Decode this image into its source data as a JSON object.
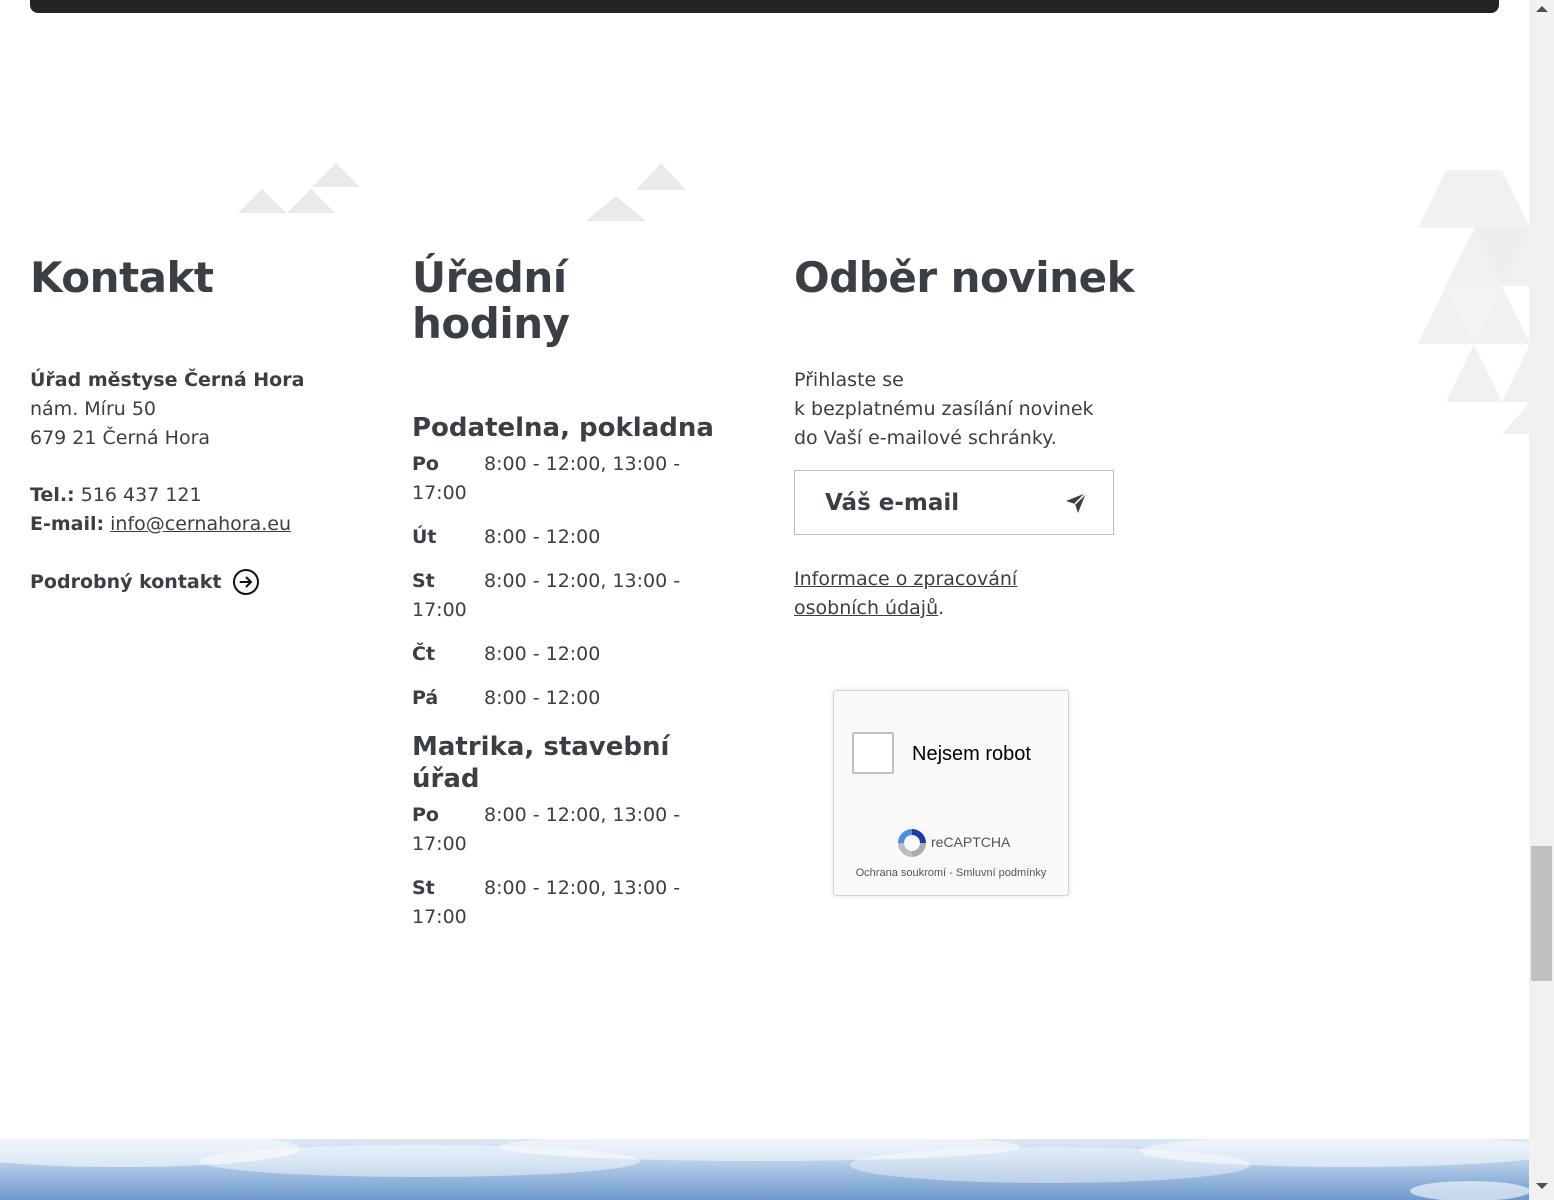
{
  "contact": {
    "heading": "Kontakt",
    "org_name": "Úřad městyse Černá Hora",
    "street": "nám. Míru 50",
    "city": "679 21 Černá Hora",
    "tel_label": "Tel.:",
    "tel_value": "516 437 121",
    "email_label": "E-mail:",
    "email_value": "info@cernahora.eu",
    "detail_link": "Podrobný kontakt"
  },
  "hours": {
    "heading": "Úřední hodiny",
    "groups": [
      {
        "title": "Podatelna, pokladna",
        "rows": [
          {
            "day": "Po",
            "time": "8:00 - 12:00, 13:00 -",
            "time_cont": "17:00"
          },
          {
            "day": "Út",
            "time": "8:00 - 12:00",
            "time_cont": ""
          },
          {
            "day": "St",
            "time": "8:00 - 12:00, 13:00 -",
            "time_cont": "17:00"
          },
          {
            "day": "Čt",
            "time": "8:00 - 12:00",
            "time_cont": ""
          },
          {
            "day": "Pá",
            "time": "8:00 - 12:00",
            "time_cont": ""
          }
        ]
      },
      {
        "title": "Matrika, stavební úřad",
        "rows": [
          {
            "day": "Po",
            "time": "8:00 - 12:00, 13:00 -",
            "time_cont": "17:00"
          },
          {
            "day": "St",
            "time": "8:00 - 12:00, 13:00 -",
            "time_cont": "17:00"
          }
        ]
      }
    ]
  },
  "newsletter": {
    "heading": "Odběr novinek",
    "intro_line1": "Přihlaste se",
    "intro_line2": "k bezplatnému zasílání novinek",
    "intro_line3": "do Vaší e-mailové schránky.",
    "email_placeholder": "Váš e-mail",
    "privacy_line1": "Informace o zpracování",
    "privacy_line2": "osobních údajů",
    "privacy_suffix": "."
  },
  "captcha": {
    "label": "Nejsem robot",
    "brand": "reCAPTCHA",
    "privacy": "Ochrana soukromí",
    "sep": " - ",
    "terms": "Smluvní podmínky"
  },
  "icons": {
    "detail": "arrow-right-circle-icon",
    "send": "send-icon",
    "recaptcha": "recaptcha-logo-icon"
  },
  "colors": {
    "text": "#3a3f45",
    "top_bar": "#222427",
    "deco": "#e9eaeb"
  }
}
